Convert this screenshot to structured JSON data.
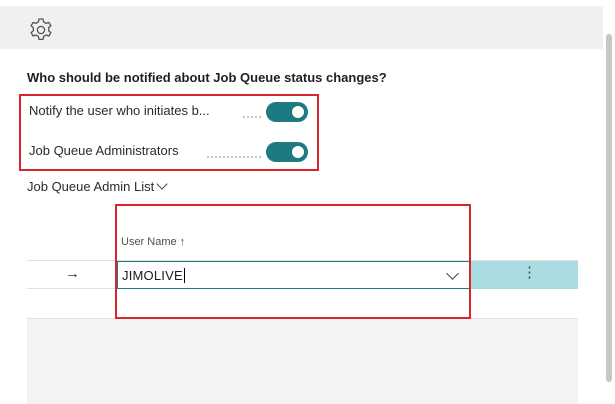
{
  "header": {
    "icon": "gear-icon"
  },
  "section": {
    "heading": "Who should be notified about Job Queue status changes?"
  },
  "toggles": [
    {
      "label": "Notify the user who initiates b...",
      "on": true
    },
    {
      "label": "Job Queue Administrators",
      "on": true
    }
  ],
  "admin_list": {
    "title": "Job Queue Admin List",
    "column_header": "User Name ↑",
    "rows": [
      {
        "indicator": "→",
        "user_name": "JIMOLIVE"
      }
    ],
    "row_menu_icon": "⋮"
  },
  "colors": {
    "accent": "#1d7a80",
    "highlight": "#d9262c",
    "selected_row": "#a9dde2"
  }
}
